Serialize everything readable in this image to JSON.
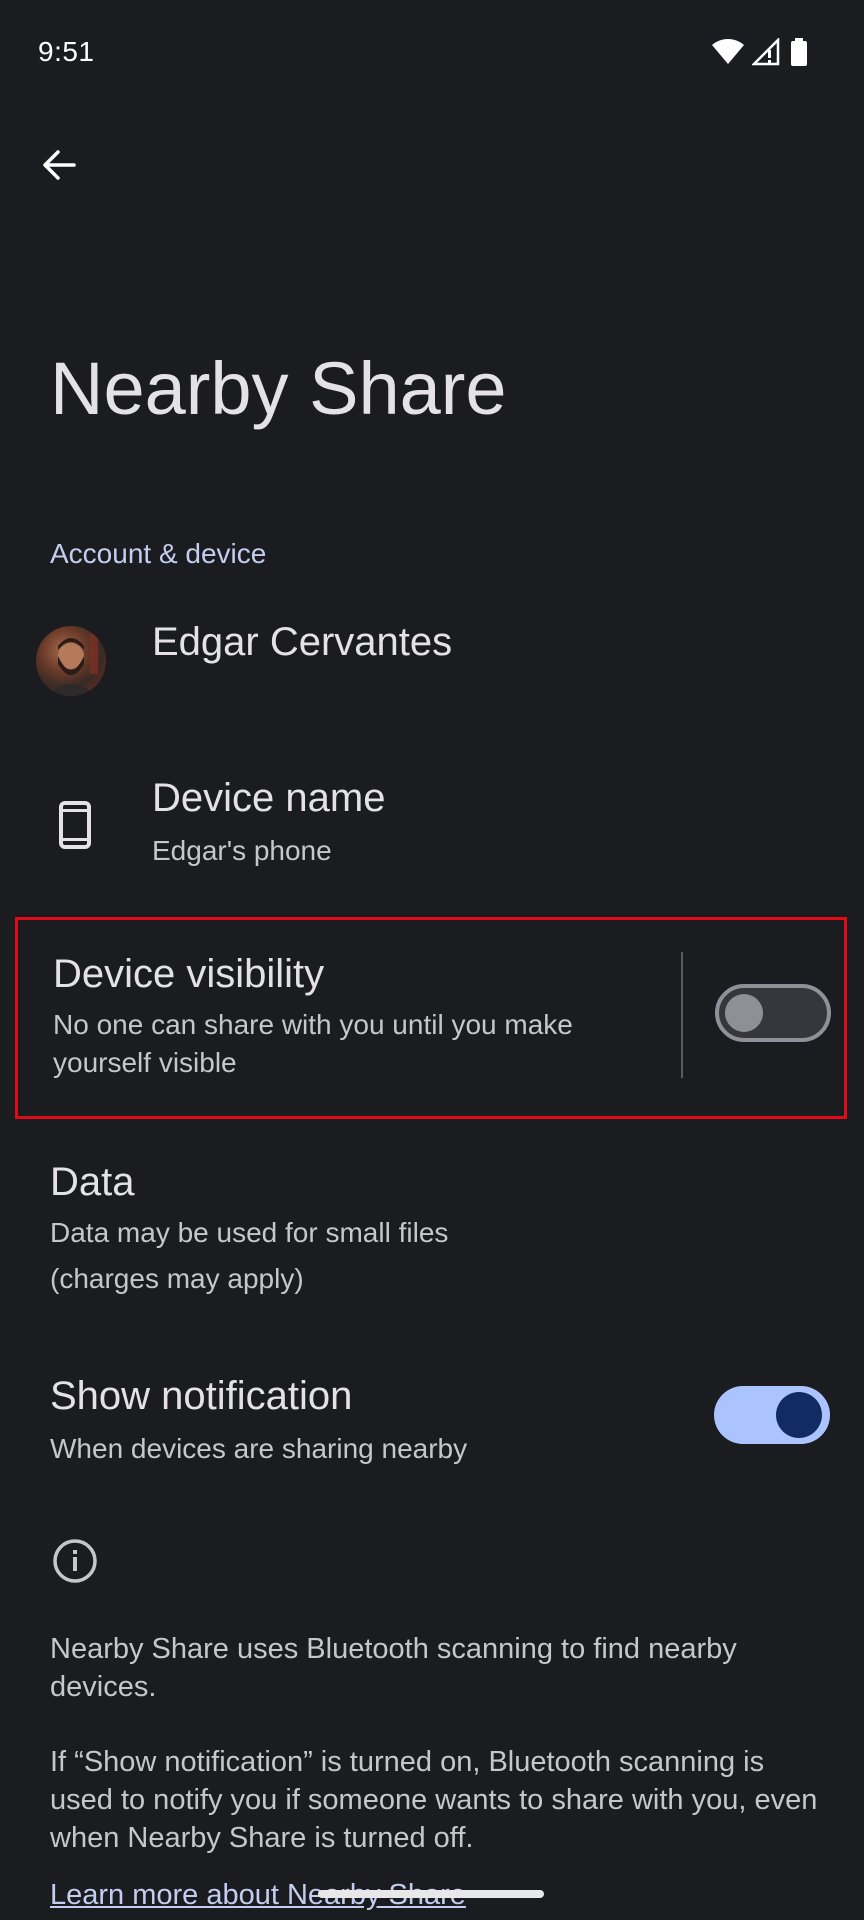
{
  "status_bar": {
    "time": "9:51",
    "icons": [
      "wifi-icon",
      "cellular-signal-icon",
      "battery-icon"
    ]
  },
  "toolbar": {
    "back_icon": "arrow-back-icon"
  },
  "page": {
    "title": "Nearby Share"
  },
  "section": {
    "account_header": "Account & device"
  },
  "account": {
    "name": "Edgar Cervantes"
  },
  "device": {
    "title": "Device name",
    "value": "Edgar's phone",
    "icon": "phone-icon"
  },
  "visibility": {
    "title": "Device visibility",
    "subtitle": "No one can share with you until you make yourself visible",
    "enabled": false
  },
  "data": {
    "title": "Data",
    "subtitle_line1": "Data may be used for small files",
    "subtitle_line2": "(charges may apply)"
  },
  "notification": {
    "title": "Show notification",
    "subtitle": "When devices are sharing nearby",
    "enabled": true
  },
  "footer": {
    "info_icon": "info-icon",
    "paragraph1": "Nearby Share uses Bluetooth scanning to find nearby devices.",
    "paragraph2": "If “Show notification” is turned on, Bluetooth scanning is used to notify you if someone wants to share with you, even when Nearby Share is turned off.",
    "learn_more": "Learn more about Nearby Share"
  },
  "colors": {
    "background": "#1b1c20",
    "accent": "#abc3ff",
    "highlight_border": "#e20a17"
  }
}
